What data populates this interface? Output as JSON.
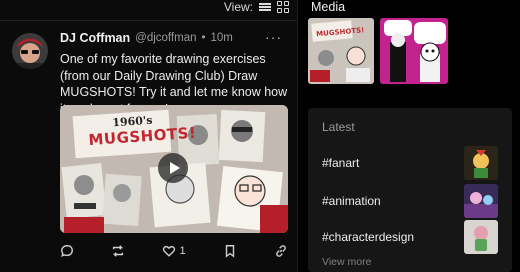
{
  "view_bar": {
    "label": "View:"
  },
  "post": {
    "author": "DJ Coffman",
    "handle": "@djcoffman",
    "separator": "•",
    "time": "10m",
    "more": "···",
    "text": "One of my favorite drawing exercises (from our Daily Drawing Club) Draw MUGSHOTS! Try it and let me know how it works out for you!",
    "media_title_line1": "1960's",
    "media_title_line2": "MUGSHOTS!",
    "like_count": "1"
  },
  "sidebar": {
    "media_title": "Media",
    "latest_title": "Latest",
    "tags": [
      {
        "label": "#fanart"
      },
      {
        "label": "#animation"
      },
      {
        "label": "#characterdesign"
      }
    ],
    "view_more": "View more"
  },
  "colors": {
    "background": "#000000",
    "panel": "#161616",
    "accent_red": "#c4262e"
  }
}
